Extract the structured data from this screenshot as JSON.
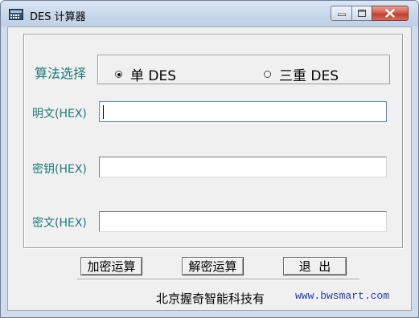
{
  "window": {
    "title": "DES 计算器",
    "controls": {
      "minimize": "minimize",
      "maximize": "maximize",
      "close": "close"
    }
  },
  "algorithm": {
    "label": "算法选择",
    "options": [
      {
        "label": "单 DES",
        "selected": true
      },
      {
        "label": "三重 DES",
        "selected": false
      }
    ]
  },
  "fields": {
    "plaintext": {
      "label": "明文(HEX)",
      "value": ""
    },
    "key": {
      "label": "密钥(HEX)",
      "value": ""
    },
    "ciphertext": {
      "label": "密文(HEX)",
      "value": ""
    }
  },
  "buttons": {
    "encrypt": "加密运算",
    "decrypt": "解密运算",
    "exit": "退  出"
  },
  "footer": {
    "company": "北京握奇智能科技有",
    "website": "www.bwsmart.com"
  },
  "colors": {
    "label_teal": "#1a7a77",
    "link_blue": "#1f3fae",
    "close_red": "#c0402f"
  }
}
